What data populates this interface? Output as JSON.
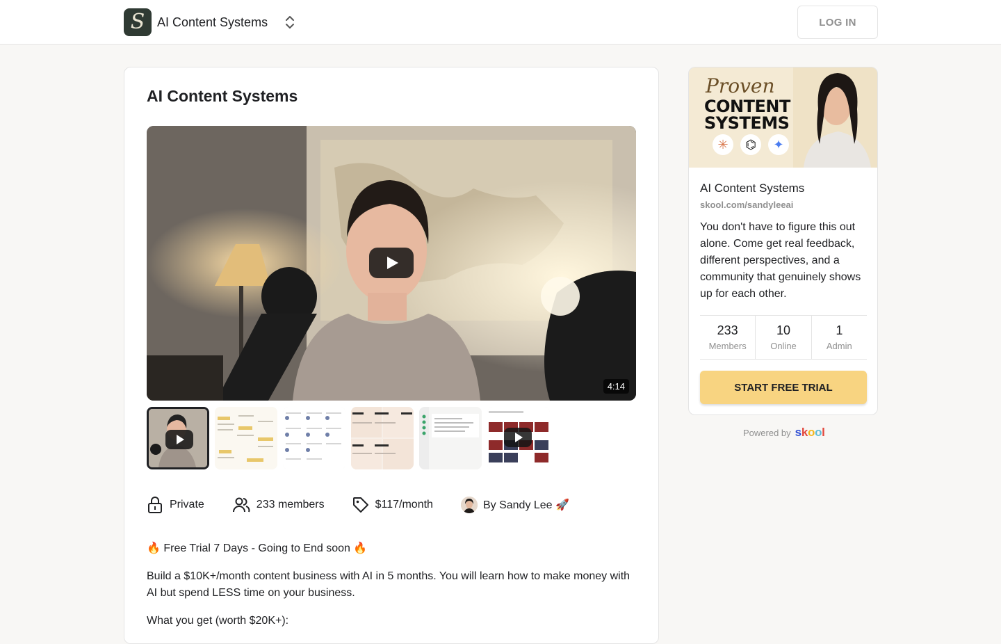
{
  "header": {
    "logo_letter": "S",
    "community_name": "AI Content Systems",
    "login_label": "LOG IN"
  },
  "main": {
    "title": "AI Content Systems",
    "video_duration": "4:14",
    "meta": {
      "privacy": "Private",
      "members": "233 members",
      "price": "$117/month",
      "author": "By Sandy Lee 🚀"
    },
    "description": [
      "🔥 Free Trial 7 Days - Going to End soon 🔥",
      "Build a $10K+/month content business with AI in 5 months. You will learn how to make money with AI but spend LESS time on your business.",
      "What you get (worth $20K+):"
    ]
  },
  "sidebar": {
    "cover": {
      "line1": "Proven",
      "line2": "CONTENT",
      "line3": "SYSTEMS"
    },
    "name": "AI Content Systems",
    "url": "skool.com/sandyleeai",
    "description": "You don't have to figure this out alone. Come get real feedback, different perspectives, and a community that genuinely shows up for each other.",
    "stats": [
      {
        "value": "233",
        "label": "Members"
      },
      {
        "value": "10",
        "label": "Online"
      },
      {
        "value": "1",
        "label": "Admin"
      }
    ],
    "cta_label": "START FREE TRIAL"
  },
  "footer": {
    "powered_by": "Powered by",
    "brand": "skool"
  },
  "colors": {
    "cta": "#f8d481",
    "muted": "#909090",
    "text": "#202124"
  }
}
